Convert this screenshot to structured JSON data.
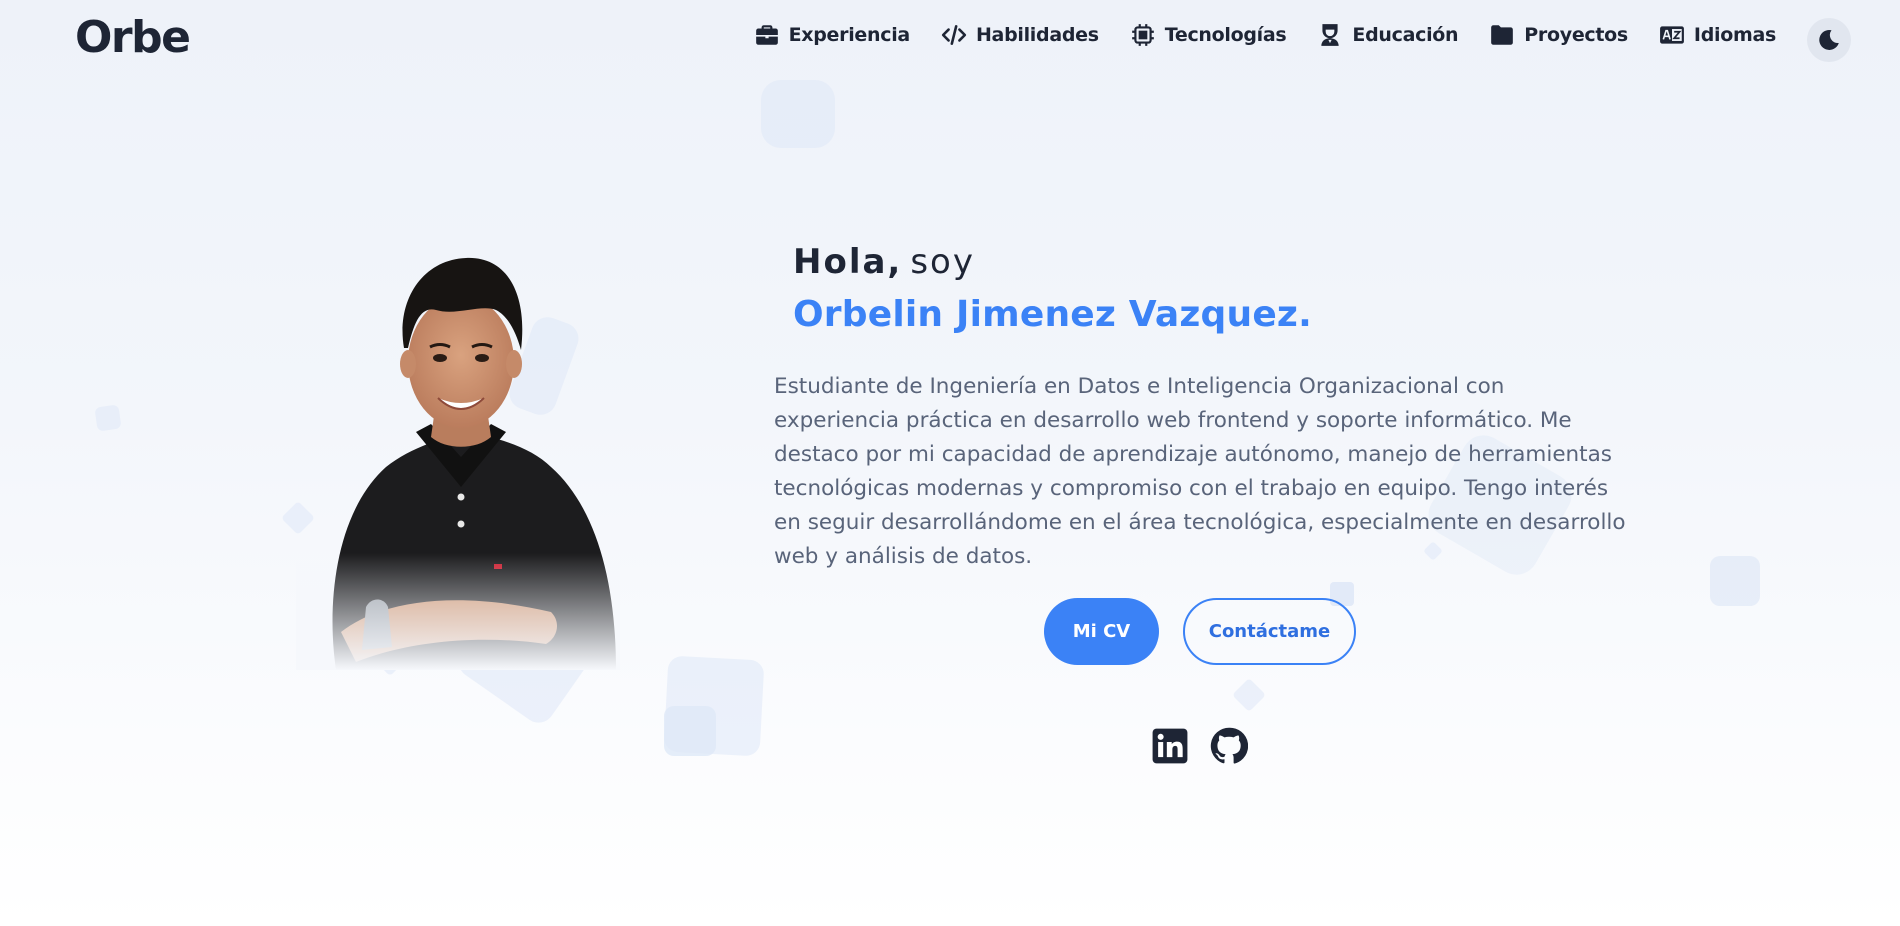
{
  "header": {
    "logo": "Orbe",
    "nav": [
      {
        "label": "Experiencia",
        "icon": "briefcase-icon"
      },
      {
        "label": "Habilidades",
        "icon": "code-icon"
      },
      {
        "label": "Tecnologías",
        "icon": "chip-icon"
      },
      {
        "label": "Educación",
        "icon": "graduate-icon"
      },
      {
        "label": "Proyectos",
        "icon": "folder-icon"
      },
      {
        "label": "Idiomas",
        "icon": "language-icon"
      }
    ],
    "theme_toggle_icon": "moon-icon"
  },
  "hero": {
    "greeting_bold": "Hola,",
    "greeting_rest": "soy",
    "name": "Orbelin Jimenez Vazquez.",
    "description": "Estudiante de Ingeniería en Datos e Inteligencia Organizacional con experiencia práctica en desarrollo web frontend y soporte informático. Me destaco por mi capacidad de aprendizaje autónomo, manejo de herramientas tecnológicas modernas y compromiso con el trabajo en equipo. Tengo interés en seguir desarrollándome en el área tecnológica, especialmente en desarrollo web y análisis de datos.",
    "cv_button": "Mi CV",
    "contact_button": "Contáctame",
    "social": [
      {
        "icon": "linkedin-icon"
      },
      {
        "icon": "github-icon"
      }
    ]
  },
  "colors": {
    "accent": "#3b82f6",
    "text_dark": "#1e2535",
    "text_muted": "#59647a",
    "background": "#eef2f9"
  }
}
